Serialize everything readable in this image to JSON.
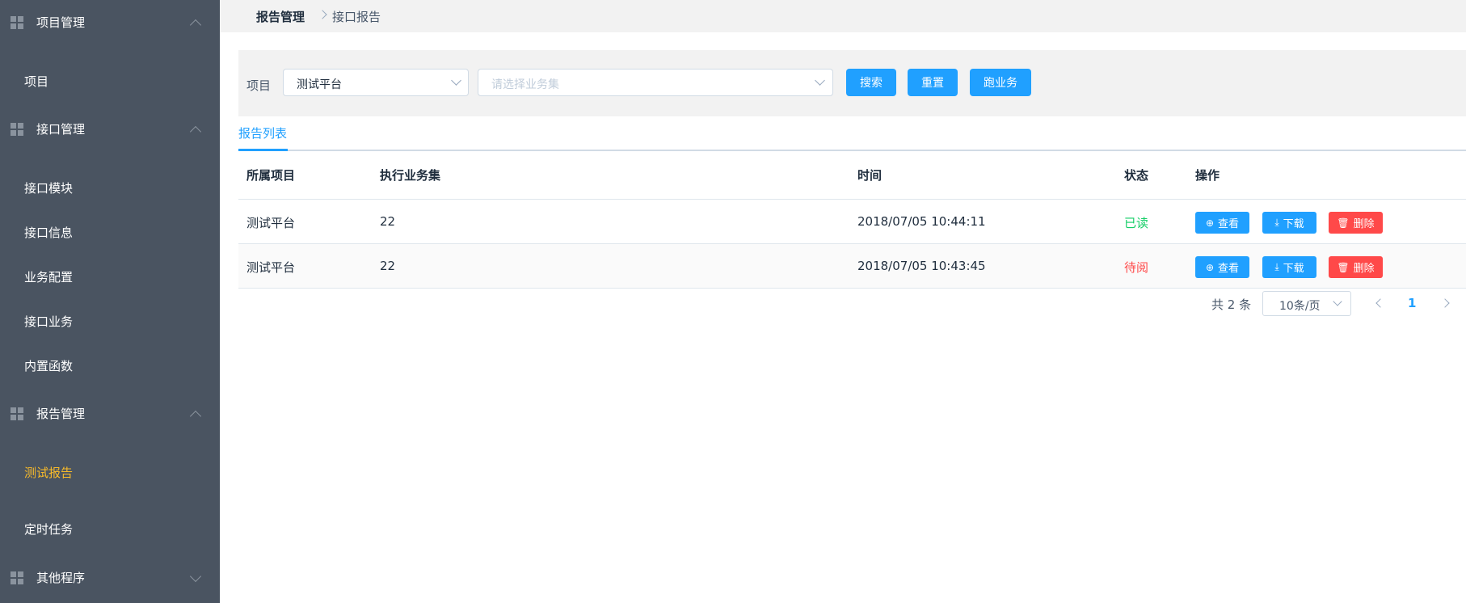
{
  "sidebar": {
    "groups": [
      {
        "label": "项目管理",
        "items": [
          "项目"
        ]
      },
      {
        "label": "接口管理",
        "items": [
          "接口模块",
          "接口信息",
          "业务配置",
          "接口业务",
          "内置函数"
        ]
      },
      {
        "label": "报告管理",
        "items": [
          "测试报告",
          "定时任务"
        ]
      },
      {
        "label": "其他程序",
        "items": []
      }
    ],
    "active_item": "测试报告"
  },
  "breadcrumb": {
    "parent": "报告管理",
    "current": "接口报告"
  },
  "filter": {
    "label": "项目",
    "project_value": "测试平台",
    "suite_placeholder": "请选择业务集",
    "search_label": "搜索",
    "reset_label": "重置",
    "run_label": "跑业务"
  },
  "tabs": [
    {
      "label": "报告列表"
    }
  ],
  "table": {
    "columns": [
      "所属项目",
      "执行业务集",
      "时间",
      "状态",
      "操作"
    ],
    "rows": [
      {
        "project": "测试平台",
        "suite": "22",
        "time": "2018/07/05 10:44:11",
        "status": "已读",
        "status_color": "#13ce66"
      },
      {
        "project": "测试平台",
        "suite": "22",
        "time": "2018/07/05 10:43:45",
        "status": "待阅",
        "status_color": "#ff4949"
      }
    ],
    "actions": {
      "view": "查看",
      "download": "下载",
      "delete": "删除"
    }
  },
  "pagination": {
    "total_text": "共 2 条",
    "page_size": "10条/页",
    "current_page": "1"
  },
  "colors": {
    "sidebar_bg": "#4a5461",
    "accent": "#20a0ff",
    "active_nav": "#f7ba2a",
    "danger": "#ff4949",
    "success": "#13ce66"
  }
}
